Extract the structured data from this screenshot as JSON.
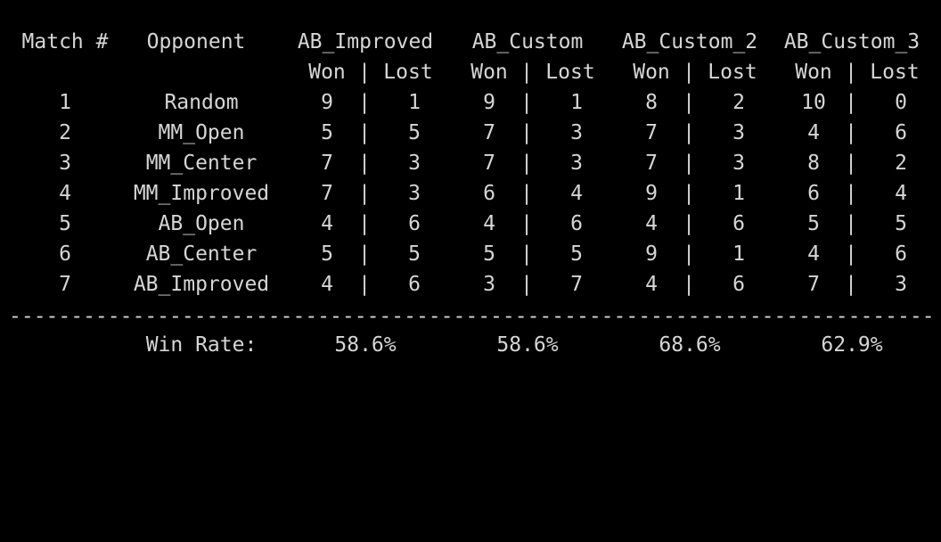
{
  "header": {
    "match": "Match #",
    "opponent": "Opponent",
    "agents": [
      "AB_Improved",
      "AB_Custom",
      "AB_Custom_2",
      "AB_Custom_3"
    ],
    "won": "Won",
    "lost": "Lost",
    "sep": "|"
  },
  "rows": [
    {
      "num": "1",
      "opponent": "Random",
      "results": [
        [
          "9",
          "1"
        ],
        [
          "9",
          "1"
        ],
        [
          "8",
          "2"
        ],
        [
          "10",
          "0"
        ]
      ]
    },
    {
      "num": "2",
      "opponent": "MM_Open",
      "results": [
        [
          "5",
          "5"
        ],
        [
          "7",
          "3"
        ],
        [
          "7",
          "3"
        ],
        [
          "4",
          "6"
        ]
      ]
    },
    {
      "num": "3",
      "opponent": "MM_Center",
      "results": [
        [
          "7",
          "3"
        ],
        [
          "7",
          "3"
        ],
        [
          "7",
          "3"
        ],
        [
          "8",
          "2"
        ]
      ]
    },
    {
      "num": "4",
      "opponent": "MM_Improved",
      "results": [
        [
          "7",
          "3"
        ],
        [
          "6",
          "4"
        ],
        [
          "9",
          "1"
        ],
        [
          "6",
          "4"
        ]
      ]
    },
    {
      "num": "5",
      "opponent": "AB_Open",
      "results": [
        [
          "4",
          "6"
        ],
        [
          "4",
          "6"
        ],
        [
          "4",
          "6"
        ],
        [
          "5",
          "5"
        ]
      ]
    },
    {
      "num": "6",
      "opponent": "AB_Center",
      "results": [
        [
          "5",
          "5"
        ],
        [
          "5",
          "5"
        ],
        [
          "9",
          "1"
        ],
        [
          "4",
          "6"
        ]
      ]
    },
    {
      "num": "7",
      "opponent": "AB_Improved",
      "results": [
        [
          "4",
          "6"
        ],
        [
          "3",
          "7"
        ],
        [
          "4",
          "6"
        ],
        [
          "7",
          "3"
        ]
      ]
    }
  ],
  "footer": {
    "label": "Win Rate:",
    "rates": [
      "58.6%",
      "58.6%",
      "68.6%",
      "62.9%"
    ]
  },
  "divider": "------------------------------------------------------------------------------------------------------------------------------------------------------------------------------------"
}
